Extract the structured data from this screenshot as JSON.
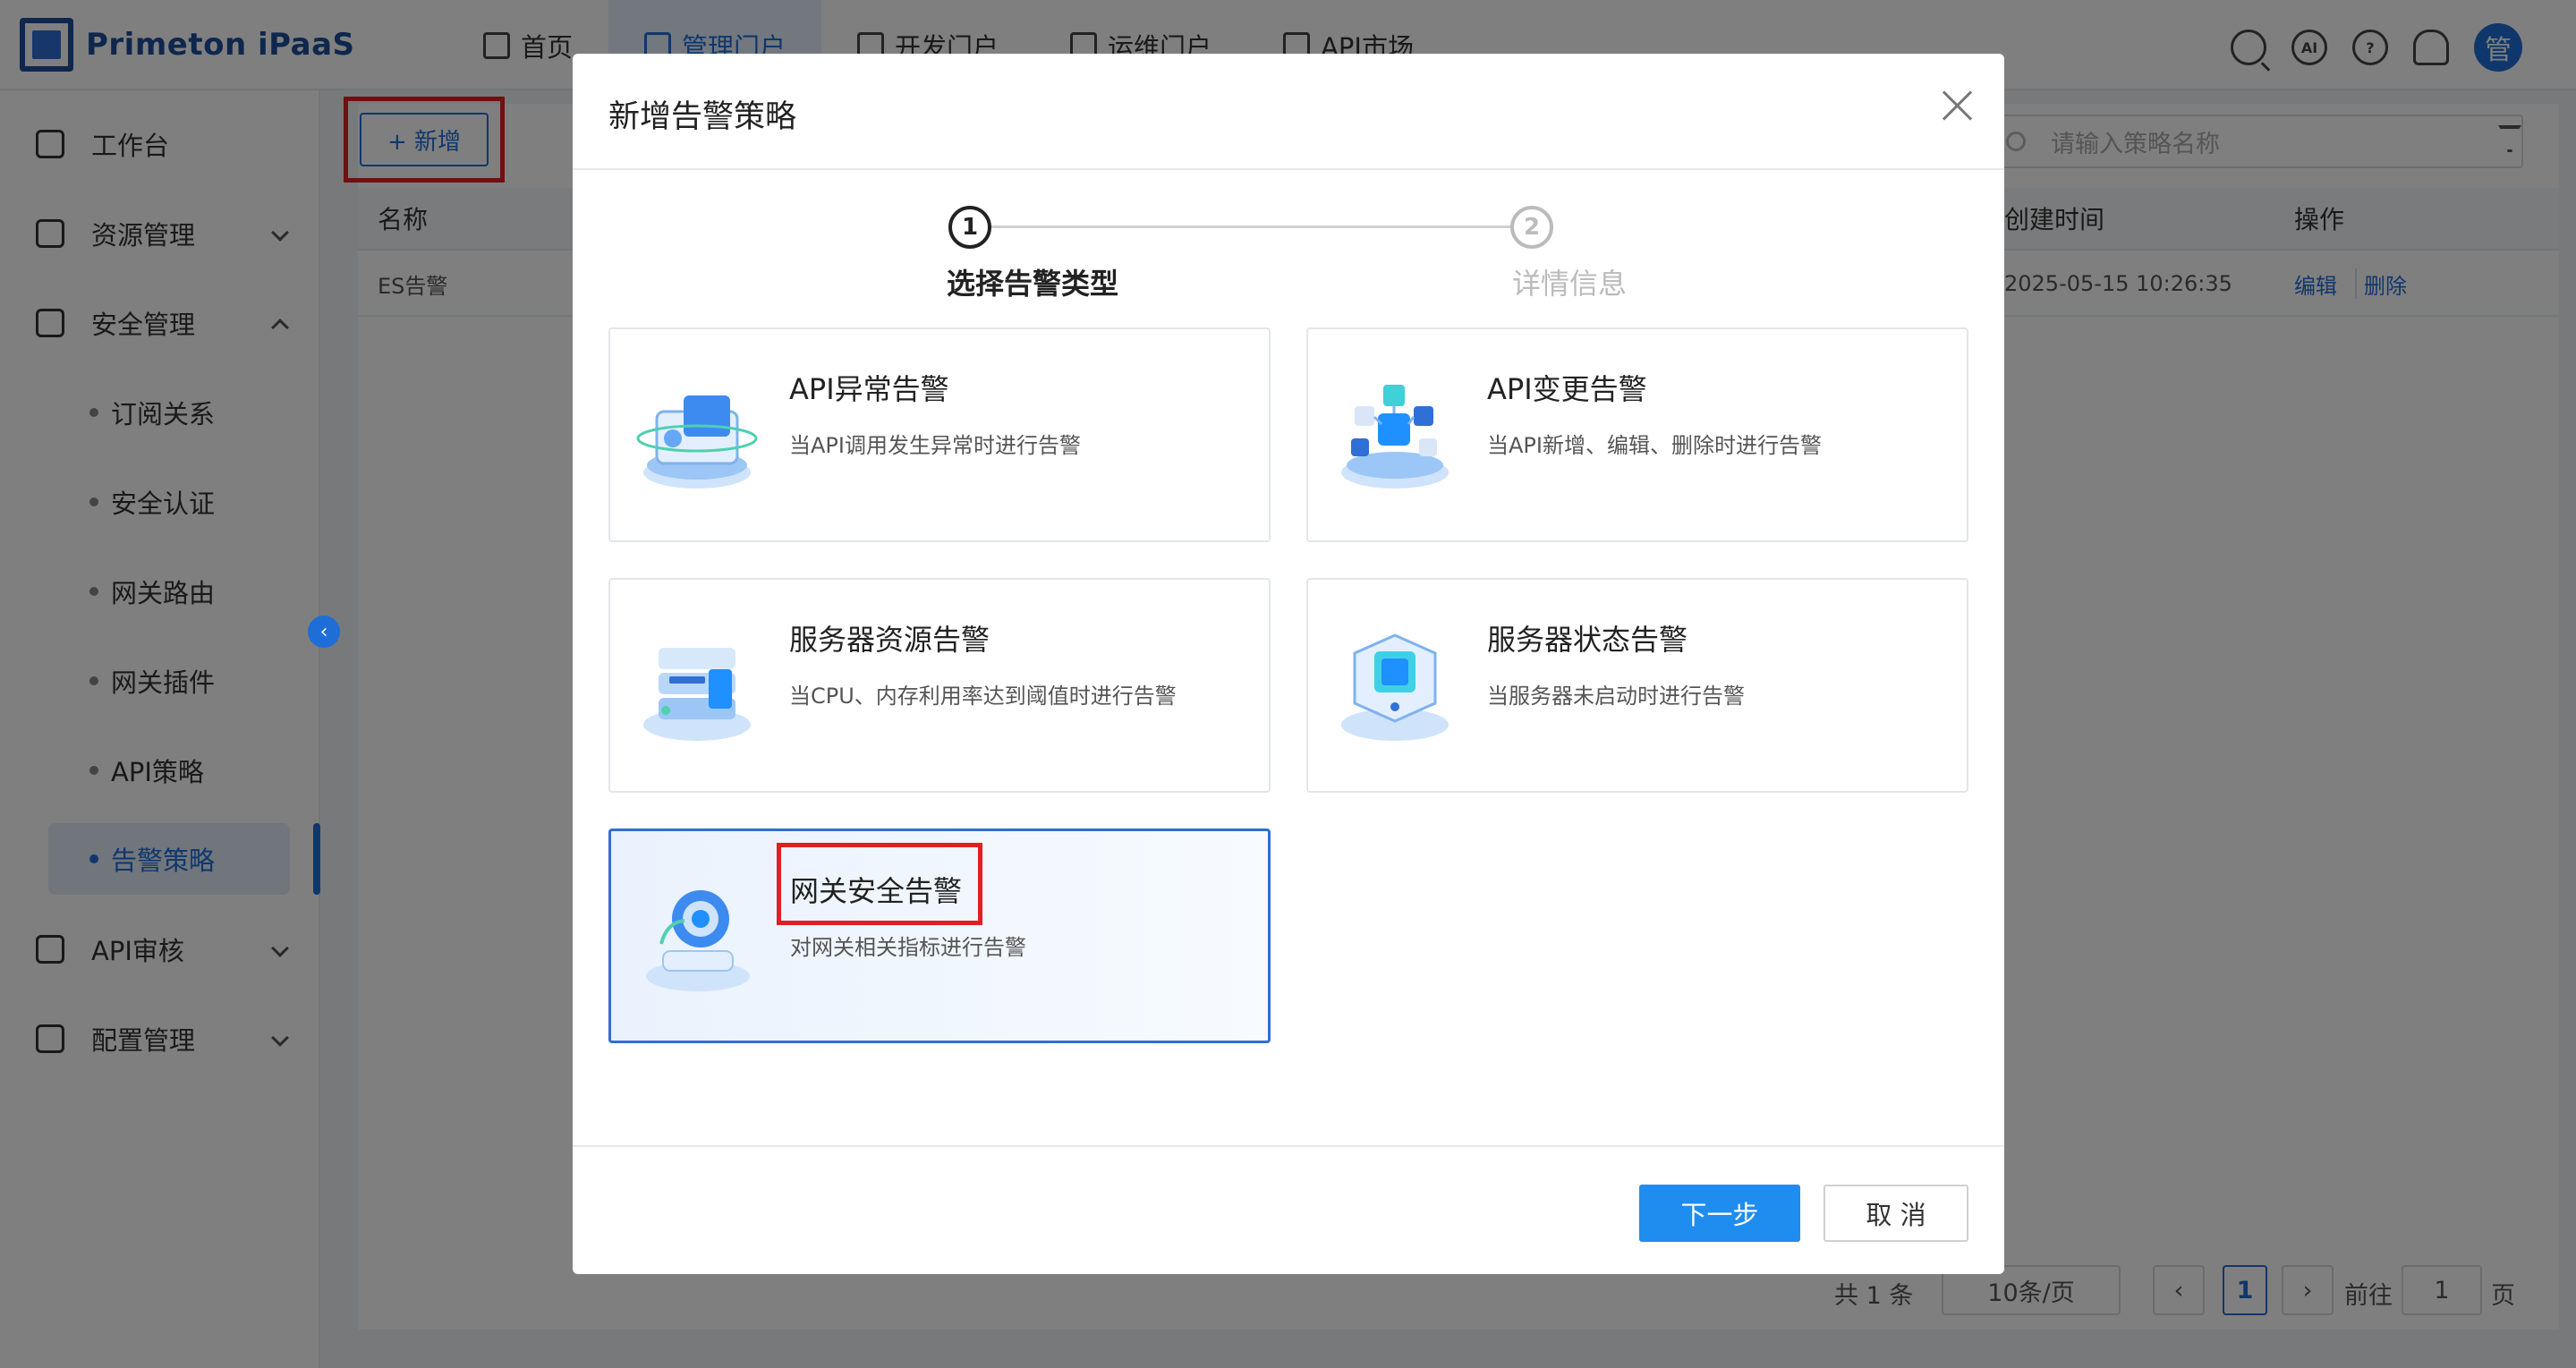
{
  "app": {
    "name": "Primeton iPaaS"
  },
  "nav": {
    "items": [
      {
        "label": "首页"
      },
      {
        "label": "管理门户"
      },
      {
        "label": "开发门户"
      },
      {
        "label": "运维门户"
      },
      {
        "label": "API市场"
      }
    ],
    "active_index": 1
  },
  "header": {
    "ai_label": "AI",
    "avatar_text": "管"
  },
  "sidebar": {
    "items": [
      {
        "label": "工作台"
      },
      {
        "label": "资源管理"
      },
      {
        "label": "安全管理"
      },
      {
        "label": "API审核"
      },
      {
        "label": "配置管理"
      }
    ],
    "sub_items": [
      {
        "label": "订阅关系"
      },
      {
        "label": "安全认证"
      },
      {
        "label": "网关路由"
      },
      {
        "label": "网关插件"
      },
      {
        "label": "API策略"
      },
      {
        "label": "告警策略"
      }
    ]
  },
  "toolbar": {
    "add_label": "+ 新增",
    "search_placeholder": "请输入策略名称"
  },
  "table": {
    "columns": {
      "name": "名称",
      "created": "创建时间",
      "actions": "操作"
    },
    "rows": [
      {
        "name": "ES告警",
        "created": "2025-05-15 10:26:35",
        "edit": "编辑",
        "delete": "删除"
      }
    ]
  },
  "pagination": {
    "total": "共 1 条",
    "page_size": "10条/页",
    "current": "1",
    "goto_label": "前往",
    "goto_value": "1",
    "page_suffix": "页"
  },
  "modal": {
    "title": "新增告警策略",
    "steps": [
      {
        "num": "1",
        "label": "选择告警类型"
      },
      {
        "num": "2",
        "label": "详情信息"
      }
    ],
    "cards": [
      {
        "title": "API异常告警",
        "desc": "当API调用发生异常时进行告警"
      },
      {
        "title": "API变更告警",
        "desc": "当API新增、编辑、删除时进行告警"
      },
      {
        "title": "服务器资源告警",
        "desc": "当CPU、内存利用率达到阈值时进行告警"
      },
      {
        "title": "服务器状态告警",
        "desc": "当服务器未启动时进行告警"
      },
      {
        "title": "网关安全告警",
        "desc": "对网关相关指标进行告警"
      }
    ],
    "selected_card_index": 4,
    "next_label": "下一步",
    "cancel_label": "取 消"
  }
}
